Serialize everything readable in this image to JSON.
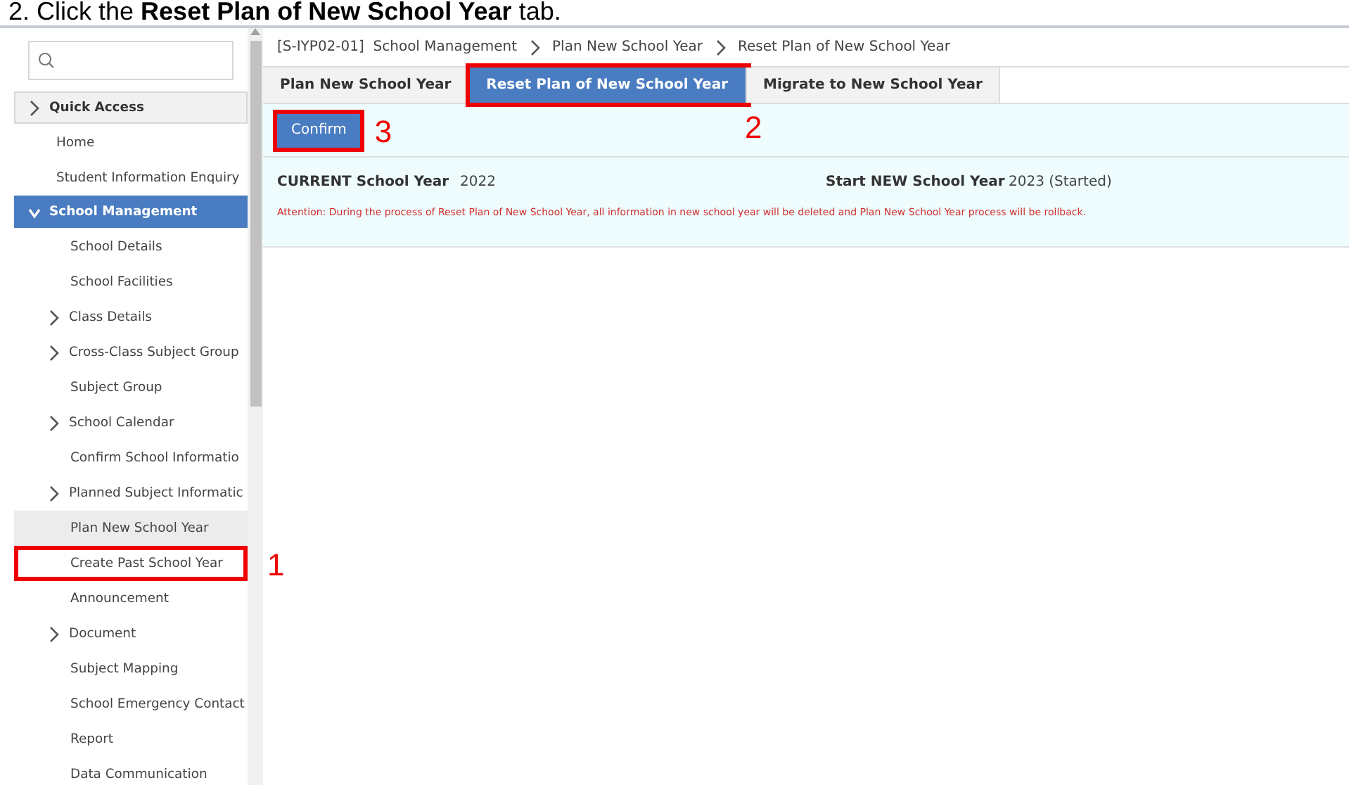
{
  "caption": "2.  Click the **Reset Plan of New School Year** tab.",
  "sidebar": {
    "items": [
      {
        "label": "Quick Access",
        "kind": "section",
        "expanded": false,
        "selected": false
      },
      {
        "label": "Home",
        "kind": "link",
        "selected": false
      },
      {
        "label": "Student Information Enquiry",
        "kind": "link",
        "selected": false
      },
      {
        "label": "School Management",
        "kind": "section",
        "expanded": true,
        "selected": true,
        "children": [
          {
            "label": "School Details",
            "kind": "link",
            "selected": false
          },
          {
            "label": "School Facilities",
            "kind": "link",
            "selected": false
          },
          {
            "label": "Class Details",
            "kind": "folder",
            "expanded": false,
            "selected": false
          },
          {
            "label": "Cross-Class Subject Group",
            "kind": "folder",
            "expanded": false,
            "selected": false
          },
          {
            "label": "Subject Group",
            "kind": "link",
            "selected": false
          },
          {
            "label": "School Calendar",
            "kind": "folder",
            "expanded": false,
            "selected": false
          },
          {
            "label": "Confirm School Informatio",
            "kind": "link",
            "selected": false
          },
          {
            "label": "Planned Subject Informatic",
            "kind": "folder",
            "expanded": false,
            "selected": false
          },
          {
            "label": "Plan New School Year",
            "kind": "link",
            "selected": true
          },
          {
            "label": "Create Past School Year",
            "kind": "link",
            "selected": false,
            "callout": "1"
          },
          {
            "label": "Announcement",
            "kind": "link",
            "selected": false
          },
          {
            "label": "Document",
            "kind": "folder",
            "expanded": false,
            "selected": false
          },
          {
            "label": "Subject Mapping",
            "kind": "link",
            "selected": false
          },
          {
            "label": "School Emergency Contact",
            "kind": "link",
            "selected": false
          },
          {
            "label": "Report",
            "kind": "link",
            "selected": false
          },
          {
            "label": "Data Communication",
            "kind": "link",
            "selected": false
          }
        ]
      }
    ]
  },
  "breadcrumb": [
    "[S-IYP02-01]  School Management",
    "Plan New School Year",
    "Reset Plan of New School Year"
  ],
  "tabs": [
    {
      "label": "Plan New School Year",
      "selected": false
    },
    {
      "label": "Reset Plan of New School Year",
      "selected": true,
      "callout": "2"
    },
    {
      "label": "Migrate to New School Year",
      "selected": false
    }
  ],
  "confirm_button": {
    "label": "Confirm",
    "callout": "3"
  },
  "fields": [
    {
      "label": "CURRENT School Year",
      "value": "2022"
    },
    {
      "label": "Start NEW School Year",
      "value": "2023 (Started)"
    }
  ],
  "attention": "Attention: During the process of Reset Plan of New School Year, all information in new school year will be deleted and Plan New School Year process will be rollback."
}
